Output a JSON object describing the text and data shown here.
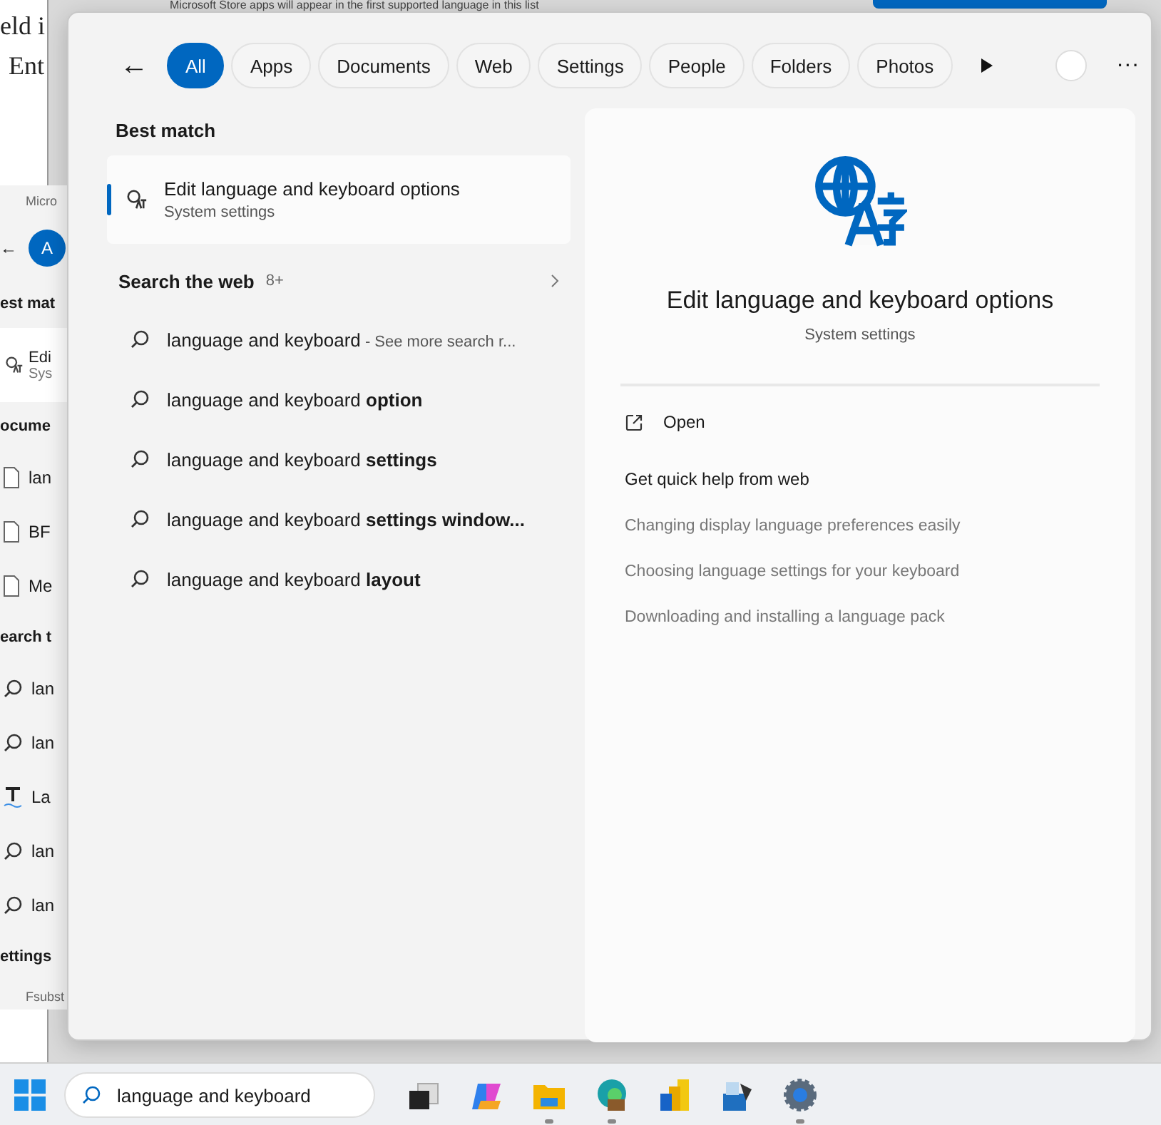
{
  "background": {
    "document_lines": [
      "eld i",
      "Ent"
    ],
    "notice": "Microsoft Store apps will appear in the first supported language in this list",
    "back_panel": [
      {
        "kind": "caption",
        "text": "Micro"
      },
      {
        "kind": "tabs",
        "back": "←",
        "text": "A"
      },
      {
        "kind": "heading",
        "text": "est mat"
      },
      {
        "kind": "card",
        "text": "Edi",
        "subtitle": "Sys"
      },
      {
        "kind": "heading",
        "text": "ocume"
      },
      {
        "kind": "document",
        "text": "lan"
      },
      {
        "kind": "document",
        "text": "BF"
      },
      {
        "kind": "document",
        "text": "Me"
      },
      {
        "kind": "heading",
        "text": "earch t"
      },
      {
        "kind": "search",
        "text": "lan"
      },
      {
        "kind": "search",
        "text": "lan"
      },
      {
        "kind": "font",
        "text": "La"
      },
      {
        "kind": "search",
        "text": "lan"
      },
      {
        "kind": "search",
        "text": "lan"
      },
      {
        "kind": "heading",
        "text": "ettings"
      },
      {
        "kind": "caption",
        "text": "Fsubst"
      }
    ]
  },
  "search_panel": {
    "back": "←",
    "more": "···",
    "tabs": [
      {
        "label": "All",
        "selected": true
      },
      {
        "label": "Apps",
        "selected": false
      },
      {
        "label": "Documents",
        "selected": false
      },
      {
        "label": "Web",
        "selected": false
      },
      {
        "label": "Settings",
        "selected": false
      },
      {
        "label": "People",
        "selected": false
      },
      {
        "label": "Folders",
        "selected": false
      },
      {
        "label": "Photos",
        "selected": false
      }
    ],
    "best_match": {
      "heading": "Best match",
      "title": "Edit language and keyboard options",
      "subtitle": "System settings",
      "selected": true
    },
    "web": {
      "heading": "Search the web",
      "count": "8+",
      "results": [
        {
          "text": "language and keyboard",
          "hint": " - See more search r..."
        },
        {
          "text": "language and keyboard **option**"
        },
        {
          "text": "language and keyboard **settings**"
        },
        {
          "text": "language and keyboard **settings window...**"
        },
        {
          "text": "language and keyboard **layout**"
        }
      ]
    },
    "preview": {
      "title": "Edit language and keyboard options",
      "subtitle": "System settings",
      "open": "Open",
      "help_heading": "Get quick help from web",
      "help_links": [
        "Changing display language preferences easily",
        "Choosing language settings for your keyboard",
        "Downloading and installing a language pack"
      ]
    }
  },
  "taskbar": {
    "search_value": "language and keyboard",
    "apps": [
      {
        "kind": "taskview",
        "running": false
      },
      {
        "kind": "copilot",
        "running": false
      },
      {
        "kind": "explorer",
        "running": true
      },
      {
        "kind": "edge",
        "running": true
      },
      {
        "kind": "powerbi",
        "running": false
      },
      {
        "kind": "dax",
        "running": false
      },
      {
        "kind": "settings",
        "running": true
      }
    ]
  }
}
